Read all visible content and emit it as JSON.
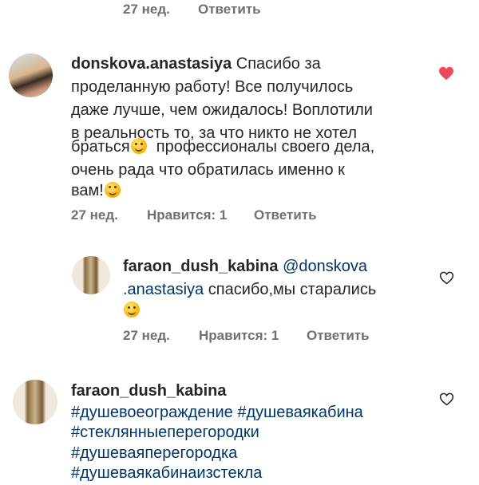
{
  "top_meta": {
    "time": "27 нед.",
    "reply": "Ответить"
  },
  "comment1": {
    "username": "donskova.anastasiya",
    "lines": [
      "Спасибо за",
      "проделанную работу! Все получилось",
      "даже лучше, чем ожидалось! Воплотили",
      "в реальность то, за что никто не хотел",
      "браться",
      "профессионалы своего дела,",
      "очень рада что обратилась именно к",
      "вам!"
    ],
    "emoji_1": "smiling-face-emoji",
    "emoji_2": "hugging-face-emoji",
    "time": "27 нед.",
    "likes": "Нравится: 1",
    "reply": "Ответить",
    "heart_color": "#ed4956",
    "liked": true
  },
  "reply1": {
    "username": "faraon_dush_kabina",
    "mention_1": "@donskova",
    "mention_2": ".anastasiya",
    "text": "спасибо,мы старались",
    "emoji": "smiling-face-emoji",
    "time": "27 нед.",
    "likes": "Нравится: 1",
    "reply": "Ответить",
    "liked": false
  },
  "comment2": {
    "username": "faraon_dush_kabina",
    "tags": [
      "#душевоеограждение",
      "#душеваякабина",
      "#стеклянныеперегородки",
      "#душеваяперегородка",
      "#душеваякабинаизстекла"
    ],
    "liked": false
  },
  "colors": {
    "link": "#003569",
    "meta": "#6f6f6f",
    "text": "#262626"
  }
}
